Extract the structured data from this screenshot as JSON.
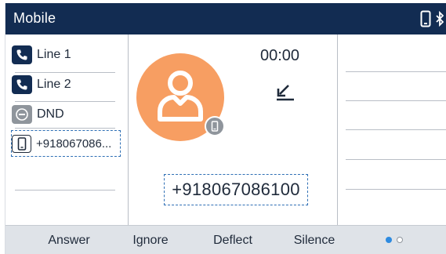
{
  "header": {
    "title": "Mobile",
    "status_icons": [
      "mobile-phone-icon",
      "bluetooth-icon"
    ]
  },
  "line_keys": [
    {
      "label": "Line 1",
      "icon": "phone-handset-icon"
    },
    {
      "label": "Line 2",
      "icon": "phone-handset-icon"
    },
    {
      "label": "DND",
      "icon": "do-not-disturb-icon"
    },
    {
      "label": "+918067086...",
      "icon": "mobile-phone-icon"
    }
  ],
  "call": {
    "timer": "00:00",
    "direction_icon": "incoming-call-arrow-icon",
    "caller_number": "+918067086100",
    "avatar_icon": "contact-avatar-icon",
    "avatar_badge_icon": "mobile-phone-icon"
  },
  "softkeys": {
    "answer": "Answer",
    "ignore": "Ignore",
    "deflect": "Deflect",
    "silence": "Silence"
  },
  "pagination": {
    "current": 1,
    "total": 2
  },
  "colors": {
    "header_bg": "#122c52",
    "avatar_bg": "#f79e62",
    "focus_border": "#2e6fb5",
    "softkey_bar": "#dfe3e8",
    "active_dot": "#2e8be0"
  }
}
